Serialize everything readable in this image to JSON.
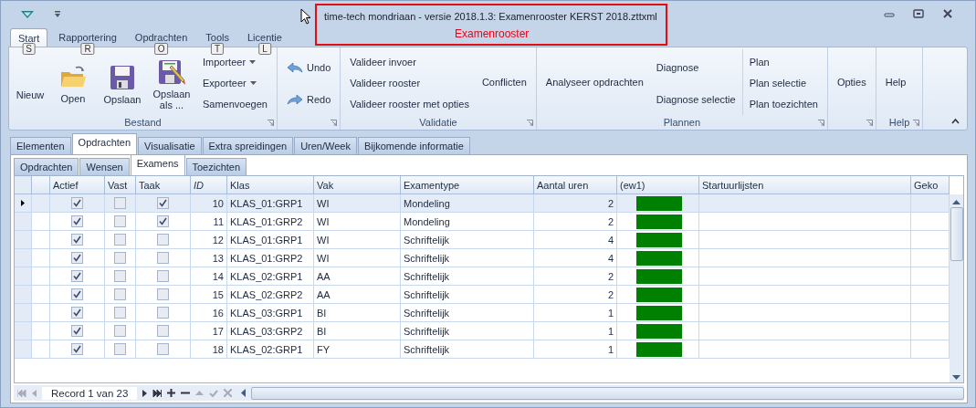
{
  "window": {
    "title": "time-tech mondriaan - versie 2018.1.3: Examenrooster KERST 2018.zttxml",
    "subtitle": "Examenrooster"
  },
  "ribbon_tabs": [
    {
      "label": "Start",
      "selected": true,
      "keytip": "S"
    },
    {
      "label": "Rapportering",
      "selected": false,
      "keytip": "R"
    },
    {
      "label": "Opdrachten",
      "selected": false,
      "keytip": "O"
    },
    {
      "label": "Tools",
      "selected": false,
      "keytip": "T"
    },
    {
      "label": "Licentie",
      "selected": false,
      "keytip": "L"
    }
  ],
  "ribbon_groups": [
    {
      "label": "Bestand",
      "columns": [
        [
          {
            "label": "Nieuw",
            "kind": "plain"
          }
        ],
        [
          {
            "label": "Open",
            "kind": "open"
          }
        ],
        [
          {
            "label": "Opslaan",
            "kind": "save"
          }
        ],
        [
          {
            "label": "Opslaan als ...",
            "kind": "saveas"
          }
        ],
        [
          {
            "label": "Importeer",
            "kind": "menu"
          },
          {
            "label": "Exporteer",
            "kind": "menu"
          },
          {
            "label": "Samenvoegen",
            "kind": "small"
          }
        ]
      ]
    },
    {
      "columns": [
        [
          {
            "label": "Undo",
            "kind": "undo"
          },
          {
            "label": "Redo",
            "kind": "redo"
          }
        ]
      ]
    },
    {
      "label": "Validatie",
      "columns": [
        [
          {
            "label": "Valideer invoer",
            "kind": "small"
          },
          {
            "label": "Valideer rooster",
            "kind": "small"
          },
          {
            "label": "Valideer rooster met opties",
            "kind": "small"
          }
        ],
        [
          {
            "label": "Conflicten",
            "kind": "small"
          }
        ]
      ]
    },
    {
      "label": "Plannen",
      "columns": [
        [
          {
            "label": "Analyseer opdrachten",
            "kind": "small"
          }
        ],
        [
          {
            "label": "Diagnose",
            "kind": "small"
          },
          {
            "label": "Diagnose selectie",
            "kind": "small"
          }
        ],
        [
          {
            "label": "Plan",
            "kind": "small"
          },
          {
            "label": "Plan selectie",
            "kind": "small"
          },
          {
            "label": "Plan toezichten",
            "kind": "small"
          }
        ]
      ]
    },
    {
      "columns": [
        [
          {
            "label": "Opties",
            "kind": "small"
          }
        ]
      ]
    },
    {
      "label": "Help",
      "columns": [
        [
          {
            "label": "Help",
            "kind": "small"
          }
        ]
      ]
    }
  ],
  "doc_tabs": [
    {
      "label": "Elementen",
      "selected": false
    },
    {
      "label": "Opdrachten",
      "selected": true
    },
    {
      "label": "Visualisatie",
      "selected": false
    },
    {
      "label": "Extra spreidingen",
      "selected": false
    },
    {
      "label": "Uren/Week",
      "selected": false
    },
    {
      "label": "Bijkomende informatie",
      "selected": false
    }
  ],
  "sub_tabs": [
    {
      "label": "Opdrachten",
      "selected": false
    },
    {
      "label": "Wensen",
      "selected": false
    },
    {
      "label": "Examens",
      "selected": true
    },
    {
      "label": "Toezichten",
      "selected": false
    }
  ],
  "table": {
    "columns": [
      "Actief",
      "Vast",
      "Taak",
      "ID",
      "Klas",
      "Vak",
      "Examentype",
      "Aantal uren",
      "(ew1)",
      "Startuurlijsten",
      "Geko"
    ],
    "rows": [
      {
        "selected": true,
        "actief": true,
        "vast": false,
        "taak": true,
        "id": "10",
        "klas": "KLAS_01:GRP1",
        "vak": "WI",
        "examentype": "Mondeling",
        "uren": "2",
        "color": "#008000"
      },
      {
        "selected": false,
        "actief": true,
        "vast": false,
        "taak": true,
        "id": "11",
        "klas": "KLAS_01:GRP2",
        "vak": "WI",
        "examentype": "Mondeling",
        "uren": "2",
        "color": "#008000"
      },
      {
        "selected": false,
        "actief": true,
        "vast": false,
        "taak": false,
        "id": "12",
        "klas": "KLAS_01:GRP1",
        "vak": "WI",
        "examentype": "Schriftelijk",
        "uren": "4",
        "color": "#008000"
      },
      {
        "selected": false,
        "actief": true,
        "vast": false,
        "taak": false,
        "id": "13",
        "klas": "KLAS_01:GRP2",
        "vak": "WI",
        "examentype": "Schriftelijk",
        "uren": "4",
        "color": "#008000"
      },
      {
        "selected": false,
        "actief": true,
        "vast": false,
        "taak": false,
        "id": "14",
        "klas": "KLAS_02:GRP1",
        "vak": "AA",
        "examentype": "Schriftelijk",
        "uren": "2",
        "color": "#008000"
      },
      {
        "selected": false,
        "actief": true,
        "vast": false,
        "taak": false,
        "id": "15",
        "klas": "KLAS_02:GRP2",
        "vak": "AA",
        "examentype": "Schriftelijk",
        "uren": "2",
        "color": "#008000"
      },
      {
        "selected": false,
        "actief": true,
        "vast": false,
        "taak": false,
        "id": "16",
        "klas": "KLAS_03:GRP1",
        "vak": "BI",
        "examentype": "Schriftelijk",
        "uren": "1",
        "color": "#008000"
      },
      {
        "selected": false,
        "actief": true,
        "vast": false,
        "taak": false,
        "id": "17",
        "klas": "KLAS_03:GRP2",
        "vak": "BI",
        "examentype": "Schriftelijk",
        "uren": "1",
        "color": "#008000"
      },
      {
        "selected": false,
        "actief": true,
        "vast": false,
        "taak": false,
        "id": "18",
        "klas": "KLAS_02:GRP1",
        "vak": "FY",
        "examentype": "Schriftelijk",
        "uren": "1",
        "color": "#008000"
      }
    ]
  },
  "navigator": {
    "record": "Record 1 van 23"
  }
}
